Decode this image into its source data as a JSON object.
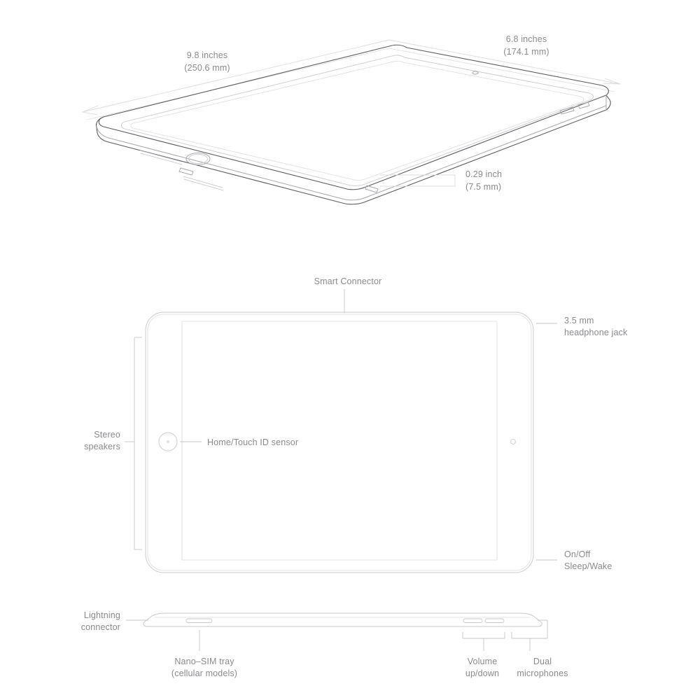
{
  "diagram": {
    "title": "iPad dimensions and features diagram",
    "views": {
      "perspective": "perspective-top-view",
      "front": "front-view",
      "edge": "bottom-edge-view"
    }
  },
  "dimensions": {
    "width": {
      "inches": "9.8 inches",
      "mm": "(250.6 mm)"
    },
    "depth": {
      "inches": "6.8 inches",
      "mm": "(174.1 mm)"
    },
    "thickness": {
      "inches": "0.29 inch",
      "mm": "(7.5 mm)"
    }
  },
  "callouts": {
    "smart_connector": "Smart Connector",
    "headphone_jack_line1": "3.5 mm",
    "headphone_jack_line2": "headphone jack",
    "stereo_speakers_line1": "Stereo",
    "stereo_speakers_line2": "speakers",
    "home_touch_id": "Home/Touch ID sensor",
    "on_off_line1": "On/Off",
    "on_off_line2": "Sleep/Wake",
    "lightning_line1": "Lightning",
    "lightning_line2": "connector",
    "nano_sim_line1": "Nano–SIM tray",
    "nano_sim_line2": "(cellular models)",
    "volume_line1": "Volume",
    "volume_line2": "up/down",
    "microphones_line1": "Dual",
    "microphones_line2": "microphones"
  },
  "colors": {
    "text": "#8a8a8e",
    "outline_dark": "#5d5d62",
    "outline_light": "#c9c9ce",
    "dimension_line": "#dcdcde",
    "background": "#ffffff"
  }
}
